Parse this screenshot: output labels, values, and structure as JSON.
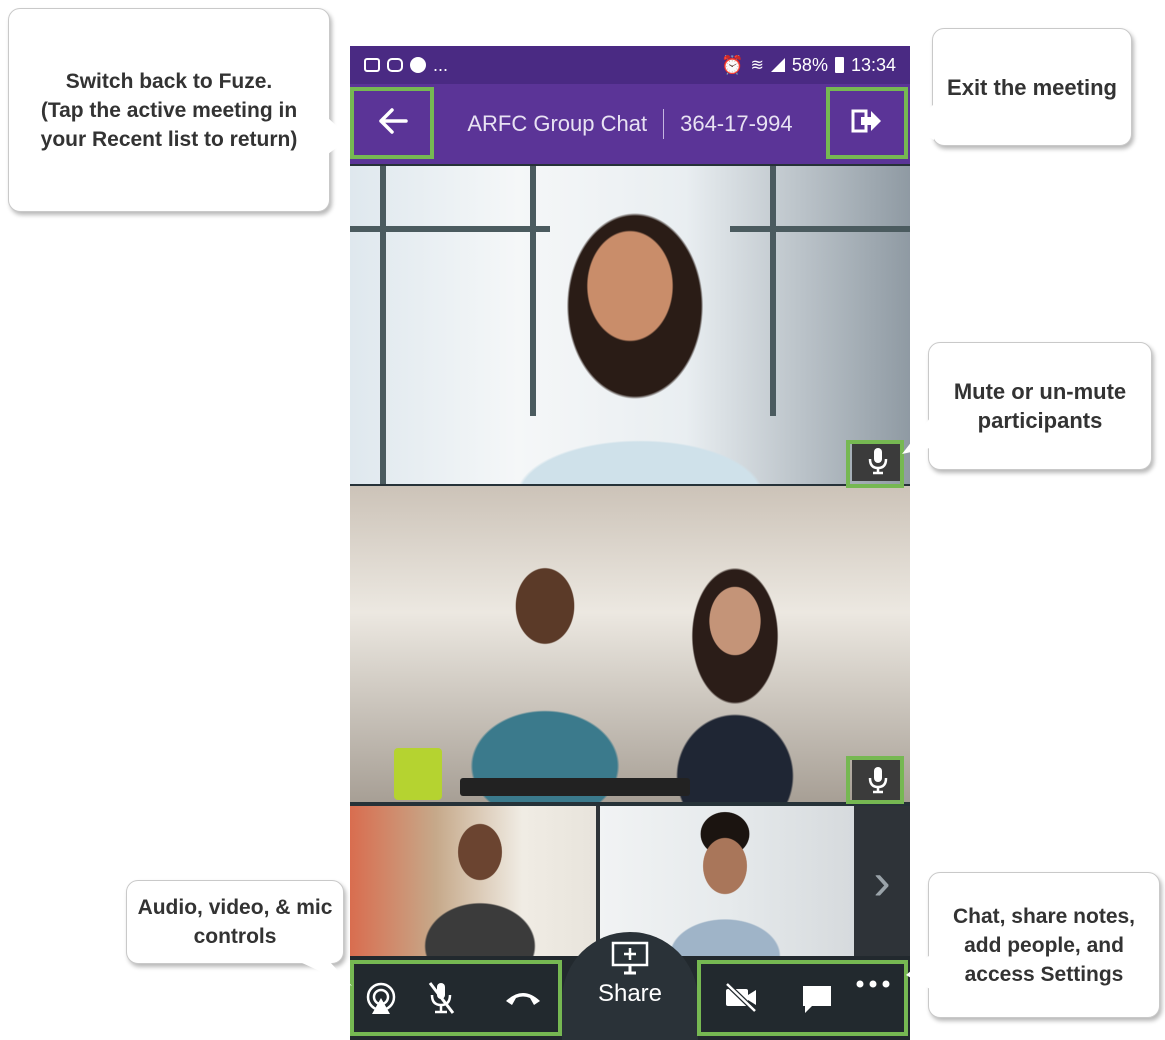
{
  "status_bar": {
    "left_more": "...",
    "battery": "58%",
    "time": "13:34"
  },
  "app_bar": {
    "meeting_name": "ARFC Group Chat",
    "meeting_id": "364-17-994"
  },
  "toolbar": {
    "share_label": "Share"
  },
  "callouts": {
    "back": "Switch back to Fuze.\n(Tap the active meeting in your Recent list to return)",
    "exit": "Exit the meeting",
    "mute": "Mute or un-mute participants",
    "controls": "Audio, video, & mic controls",
    "chat": "Chat, share notes, add people, and access Settings"
  },
  "colors": {
    "highlight": "#76b852",
    "app_bar": "#5b3497",
    "status_bar": "#4a2a83"
  }
}
